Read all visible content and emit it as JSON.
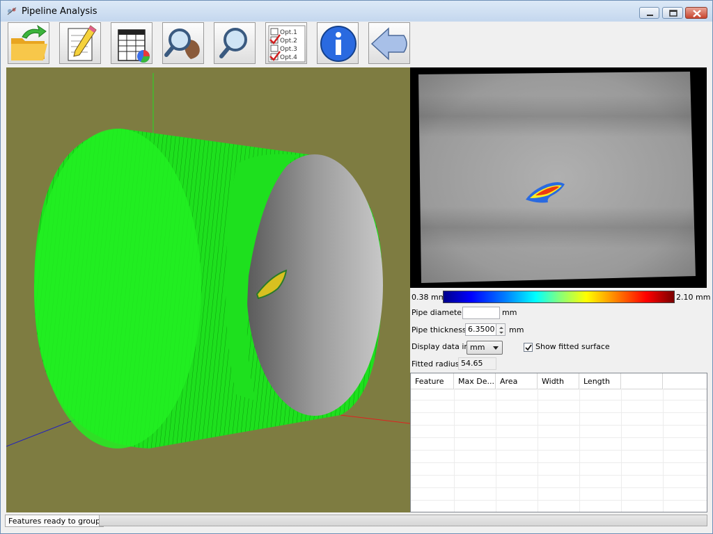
{
  "window": {
    "title": "Pipeline Analysis"
  },
  "toolbar": {
    "buttons": [
      {
        "icon": "open-folder-icon"
      },
      {
        "icon": "edit-pencil-icon"
      },
      {
        "icon": "table-chart-icon"
      },
      {
        "icon": "zoom-feature-icon"
      },
      {
        "icon": "zoom-icon"
      },
      {
        "icon": "options-checklist-icon",
        "lines": [
          "Opt.1",
          "Opt.2",
          "Opt.3",
          "Opt.4"
        ]
      },
      {
        "icon": "info-icon"
      },
      {
        "icon": "back-arrow-icon"
      }
    ]
  },
  "colorbar": {
    "min_label": "0.38 mm",
    "max_label": "2.10 mm",
    "colors": [
      "#00008a",
      "#0000ff",
      "#00ffff",
      "#ffff00",
      "#ff0000",
      "#7a0000"
    ]
  },
  "form": {
    "pipe_diameter_label": "Pipe diameter",
    "pipe_diameter_value": "",
    "pipe_diameter_unit": "mm",
    "pipe_thickness_label": "Pipe thickness",
    "pipe_thickness_value": "6.3500",
    "pipe_thickness_unit": "mm",
    "display_data_label": "Display data in",
    "display_data_value": "mm",
    "show_fitted_label": "Show fitted surface",
    "show_fitted_checked": true,
    "fitted_radius_label": "Fitted radius",
    "fitted_radius_value": "54.65"
  },
  "features_table": {
    "columns": [
      "Feature",
      "Max De...",
      "Area",
      "Width",
      "Length",
      ""
    ],
    "rows": []
  },
  "status": {
    "text": "Features ready to group",
    "progress": 0
  },
  "colors": {
    "viewport_bg": "#7e7c41",
    "wireframe": "#22ff22",
    "axis_x": "#e02020",
    "axis_y": "#22dd22",
    "axis_z": "#2020c0",
    "titlebar": "#c4d7ee"
  }
}
